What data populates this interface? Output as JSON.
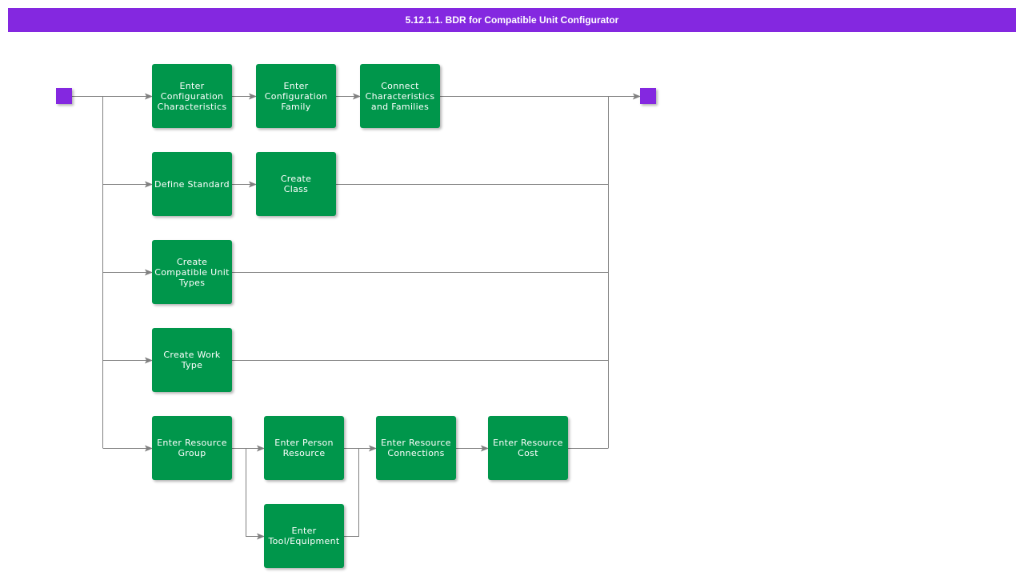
{
  "header": {
    "title": "5.12.1.1. BDR for Compatible Unit Configurator"
  },
  "colors": {
    "header": "#8428e0",
    "terminal": "#8428e0",
    "activity": "#00964b",
    "connector": "#808080"
  },
  "terminals": [
    {
      "id": "start",
      "label": "start-event"
    },
    {
      "id": "end",
      "label": "end-event"
    }
  ],
  "nodes": [
    {
      "id": "n1",
      "label": "Enter\nConfiguration\nCharacteristics"
    },
    {
      "id": "n2",
      "label": "Enter\nConfiguration\nFamily"
    },
    {
      "id": "n3",
      "label": "Connect\nCharacteristics\nand Families"
    },
    {
      "id": "n4",
      "label": "Define Standard"
    },
    {
      "id": "n5",
      "label": "Create\nClass"
    },
    {
      "id": "n6",
      "label": "Create\nCompatible Unit\nTypes"
    },
    {
      "id": "n7",
      "label": "Create Work\nType"
    },
    {
      "id": "n8",
      "label": "Enter Resource\nGroup"
    },
    {
      "id": "n9",
      "label": "Enter Person\nResource"
    },
    {
      "id": "n10",
      "label": "Enter\nTool/Equipment"
    },
    {
      "id": "n11",
      "label": "Enter Resource\nConnections"
    },
    {
      "id": "n12",
      "label": "Enter Resource\nCost"
    }
  ],
  "edges": [
    {
      "from": "start",
      "to": "n1"
    },
    {
      "from": "start",
      "to": "n4"
    },
    {
      "from": "start",
      "to": "n6"
    },
    {
      "from": "start",
      "to": "n7"
    },
    {
      "from": "start",
      "to": "n8"
    },
    {
      "from": "n1",
      "to": "n2"
    },
    {
      "from": "n2",
      "to": "n3"
    },
    {
      "from": "n3",
      "to": "end"
    },
    {
      "from": "n4",
      "to": "n5"
    },
    {
      "from": "n5",
      "to": "end"
    },
    {
      "from": "n6",
      "to": "end"
    },
    {
      "from": "n7",
      "to": "end"
    },
    {
      "from": "n8",
      "to": "n9"
    },
    {
      "from": "n8",
      "to": "n10"
    },
    {
      "from": "n9",
      "to": "n11"
    },
    {
      "from": "n10",
      "to": "n11"
    },
    {
      "from": "n11",
      "to": "n12"
    },
    {
      "from": "n12",
      "to": "end"
    }
  ]
}
